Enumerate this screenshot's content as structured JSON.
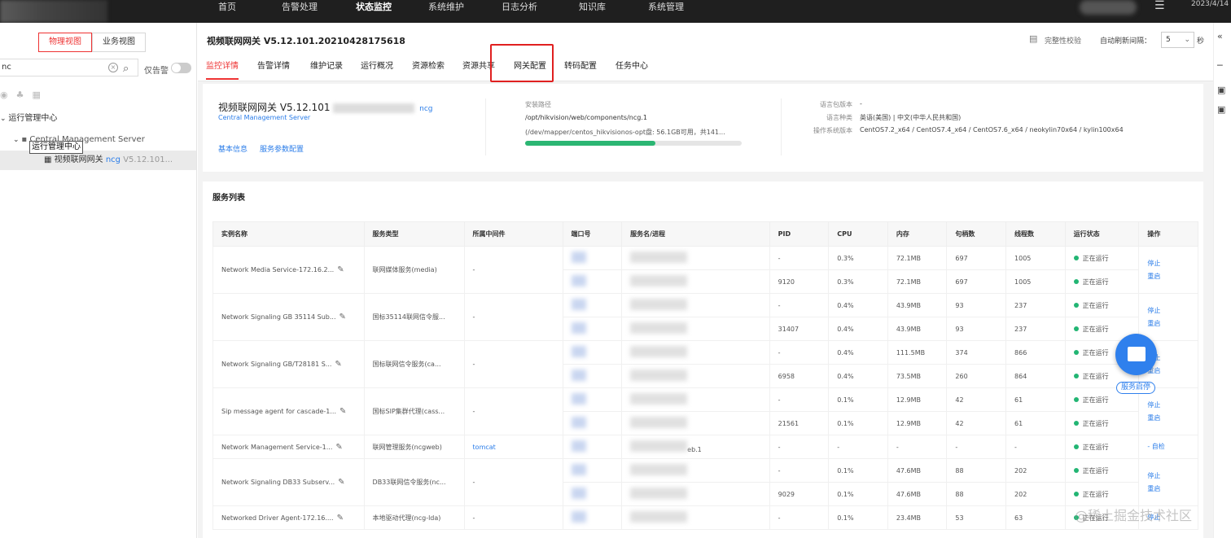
{
  "header": {
    "nav": [
      "首页",
      "告警处理",
      "状态监控",
      "系统维护",
      "日志分析",
      "知识库",
      "系统管理"
    ],
    "active_nav": "状态监控",
    "date": "2023/4/14"
  },
  "left": {
    "view_buttons": [
      "物理视图",
      "业务视图"
    ],
    "search_value": "nc",
    "only_alarm_label": "仅告警",
    "tree": {
      "root": "运行管理中心",
      "server": "Central Management Server",
      "node_name": "视频联网网关",
      "node_code": "ncg",
      "node_version": "V5.12.101..."
    },
    "tooltip": "运行管理中心"
  },
  "main": {
    "title": "视频联网网关 V5.12.101.20210428175618",
    "integrity_check": "完整性校验",
    "auto_refresh_label": "自动刷新间隔：",
    "auto_refresh_value": "5",
    "auto_refresh_unit": "秒",
    "tabs": [
      "监控详情",
      "告警详情",
      "维护记录",
      "运行概况",
      "资源检索",
      "资源共享",
      "网关配置",
      "转码配置",
      "任务中心"
    ],
    "active_tab": "监控详情",
    "highlighted_tab": "网关配置"
  },
  "summary": {
    "name": "视频联网网关 V5.12.101",
    "code": "ncg",
    "server": "Central Management Server",
    "links": [
      "基本信息",
      "服务参数配置"
    ],
    "install_path_label": "安装路径",
    "install_path": "/opt/hikvision/web/components/ncg.1",
    "disk": "(/dev/mapper/centos_hikvisionos-opt盘: 56.1GB可用，共141...",
    "disk_used_fraction": 0.6,
    "lang_pack_label": "语言包版本",
    "lang_pack_value": "-",
    "lang_label": "语言种类",
    "lang_value": "英语(美国) | 中文(中华人民共和国)",
    "os_label": "操作系统版本",
    "os_value": "CentOS7.2_x64 / CentOS7.4_x64 / CentOS7.6_x64 / neokylin70x64 / kylin100x64"
  },
  "services": {
    "title": "服务列表",
    "columns": [
      "实例名称",
      "服务类型",
      "所属中间件",
      "端口号",
      "服务名/进程",
      "PID",
      "CPU",
      "内存",
      "句柄数",
      "线程数",
      "运行状态",
      "操作"
    ],
    "status_text": "正在运行",
    "groups": [
      {
        "name": "Network Media Service-172.16.2...",
        "type": "联网媒体服务(media)",
        "middleware": "-",
        "ops": [
          "停止",
          "重启"
        ],
        "rows": [
          {
            "pid": "-",
            "cpu": "0.3%",
            "mem": "72.1MB",
            "handles": "697",
            "threads": "1005"
          },
          {
            "pid": "9120",
            "cpu": "0.3%",
            "mem": "72.1MB",
            "handles": "697",
            "threads": "1005"
          }
        ]
      },
      {
        "name": "Network Signaling GB 35114 Sub...",
        "type": "国标35114联网信令服...",
        "middleware": "-",
        "ops": [
          "停止",
          "重启"
        ],
        "rows": [
          {
            "pid": "-",
            "cpu": "0.4%",
            "mem": "43.9MB",
            "handles": "93",
            "threads": "237"
          },
          {
            "pid": "31407",
            "cpu": "0.4%",
            "mem": "43.9MB",
            "handles": "93",
            "threads": "237"
          }
        ]
      },
      {
        "name": "Network Signaling GB/T28181 S...",
        "type": "国标联网信令服务(ca...",
        "middleware": "-",
        "ops": [
          "停止",
          "重启"
        ],
        "rows": [
          {
            "pid": "-",
            "cpu": "0.4%",
            "mem": "111.5MB",
            "handles": "374",
            "threads": "866"
          },
          {
            "pid": "6958",
            "cpu": "0.4%",
            "mem": "73.5MB",
            "handles": "260",
            "threads": "864"
          }
        ]
      },
      {
        "name": "Sip message agent for cascade-1...",
        "type": "国标SIP集群代理(cass...",
        "middleware": "-",
        "ops": [
          "停止",
          "重启"
        ],
        "rows": [
          {
            "pid": "-",
            "cpu": "0.1%",
            "mem": "12.9MB",
            "handles": "42",
            "threads": "61"
          },
          {
            "pid": "21561",
            "cpu": "0.1%",
            "mem": "12.9MB",
            "handles": "42",
            "threads": "61"
          }
        ]
      },
      {
        "name": "Network Management Service-1...",
        "type": "联网管理服务(ncgweb)",
        "middleware": "tomcat",
        "ops": [
          "- 自检"
        ],
        "proc_suffix": "eb.1",
        "rows": [
          {
            "pid": "-",
            "cpu": "-",
            "mem": "-",
            "handles": "-",
            "threads": "-"
          }
        ]
      },
      {
        "name": "Network Signaling DB33 Subserv...",
        "type": "DB33联网信令服务(nc...",
        "middleware": "-",
        "ops": [
          "停止",
          "重启"
        ],
        "rows": [
          {
            "pid": "-",
            "cpu": "0.1%",
            "mem": "47.6MB",
            "handles": "88",
            "threads": "202"
          },
          {
            "pid": "9029",
            "cpu": "0.1%",
            "mem": "47.6MB",
            "handles": "88",
            "threads": "202"
          }
        ]
      },
      {
        "name": "Networked Driver Agent-172.16....",
        "type": "本地驱动代理(ncg-lda)",
        "middleware": "-",
        "ops": [
          "停止"
        ],
        "rows": [
          {
            "pid": "-",
            "cpu": "0.1%",
            "mem": "23.4MB",
            "handles": "53",
            "threads": "63"
          }
        ]
      }
    ]
  },
  "fab_label": "服务启停",
  "watermark": "@稀土掘金技术社区"
}
